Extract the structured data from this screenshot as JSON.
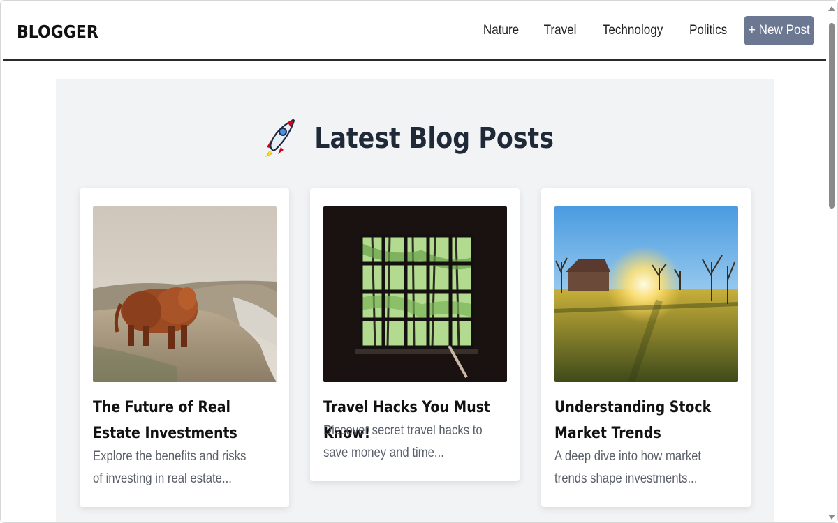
{
  "header": {
    "brand": "BLOGGER",
    "nav": [
      {
        "label": "Nature"
      },
      {
        "label": "Travel"
      },
      {
        "label": "Technology"
      },
      {
        "label": "Politics"
      }
    ],
    "new_post_label": "+ New Post",
    "new_post_color": "#6c7892"
  },
  "main": {
    "heading_icon": "rocket-icon",
    "heading": "Latest Blog Posts",
    "posts": [
      {
        "title": "The Future of Real Estate Investments",
        "description": "Explore the benefits and risks of investing in real estate...",
        "image": "highland-cow-coast-photo"
      },
      {
        "title": "Travel Hacks You Must Know!",
        "description": "Discover secret travel hacks to save money and time...",
        "image": "dark-window-trees-photo"
      },
      {
        "title": "Understanding Stock Market Trends",
        "description": "A deep dive into how market trends shape investments...",
        "image": "sunrise-field-barn-photo"
      }
    ]
  }
}
